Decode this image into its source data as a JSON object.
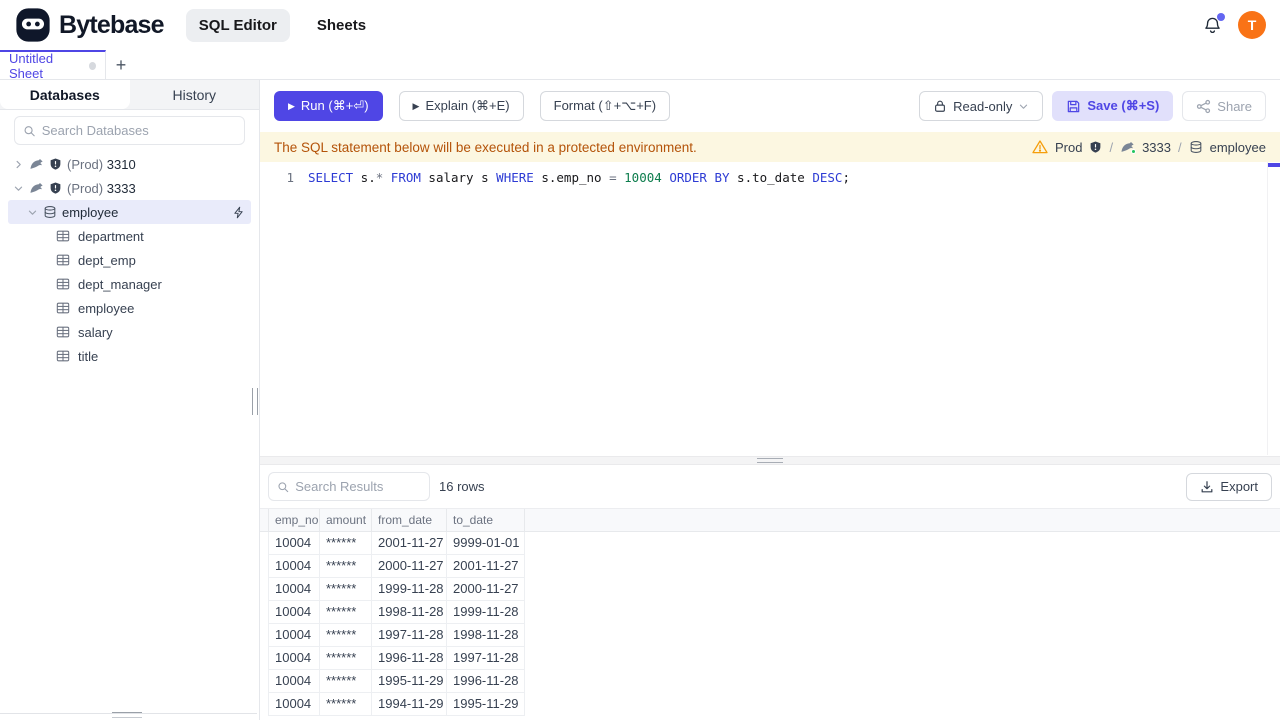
{
  "colors": {
    "accent": "#4f46e5",
    "accent_light": "#e1e0fb",
    "selected_row": "#e9ebfa",
    "banner_bg": "#fcf7e1",
    "banner_text": "#b45309",
    "warning": "#f59e0b",
    "avatar_bg": "#f97316",
    "notification_dot": "#6366f1",
    "sql_keyword": "#2d3bd4",
    "sql_number": "#0d7d4d",
    "sql_operator": "#6b7280"
  },
  "header": {
    "brand": "Bytebase",
    "nav": [
      {
        "label": "SQL Editor",
        "active": true
      },
      {
        "label": "Sheets",
        "active": false
      }
    ],
    "avatar_initial": "T"
  },
  "sheet_tabs": {
    "active_tab": "Untitled Sheet",
    "new_tab_label": "+"
  },
  "sidebar": {
    "tabs": [
      {
        "label": "Databases",
        "active": true
      },
      {
        "label": "History",
        "active": false
      }
    ],
    "search_placeholder": "Search Databases",
    "tree": {
      "instances": [
        {
          "env": "(Prod)",
          "name": "3310",
          "expanded": false
        },
        {
          "env": "(Prod)",
          "name": "3333",
          "expanded": true
        }
      ],
      "database": "employee",
      "tables": [
        "department",
        "dept_emp",
        "dept_manager",
        "employee",
        "salary",
        "title"
      ]
    }
  },
  "toolbar": {
    "run": "Run (⌘+⏎)",
    "explain": "Explain (⌘+E)",
    "format": "Format (⇧+⌥+F)",
    "readonly": "Read-only",
    "save": "Save (⌘+S)",
    "share": "Share"
  },
  "banner": {
    "message": "The SQL statement below will be executed in a protected environment.",
    "environment": "Prod",
    "instance": "3333",
    "database": "employee",
    "separator": "/"
  },
  "editor": {
    "line_number": "1",
    "sql_text": "SELECT s.* FROM salary s WHERE s.emp_no = 10004 ORDER BY s.to_date DESC;",
    "tokens": [
      {
        "text": "SELECT",
        "type": "kw"
      },
      {
        "text": " s.",
        "type": "id"
      },
      {
        "text": "*",
        "type": "op"
      },
      {
        "text": " ",
        "type": "id"
      },
      {
        "text": "FROM",
        "type": "kw"
      },
      {
        "text": " salary s ",
        "type": "id"
      },
      {
        "text": "WHERE",
        "type": "kw"
      },
      {
        "text": " s.emp_no ",
        "type": "id"
      },
      {
        "text": "=",
        "type": "op"
      },
      {
        "text": " ",
        "type": "id"
      },
      {
        "text": "10004",
        "type": "num"
      },
      {
        "text": " ",
        "type": "id"
      },
      {
        "text": "ORDER BY",
        "type": "kw"
      },
      {
        "text": " s.to_date ",
        "type": "id"
      },
      {
        "text": "DESC",
        "type": "kw"
      },
      {
        "text": ";",
        "type": "id"
      }
    ]
  },
  "results": {
    "search_placeholder": "Search Results",
    "row_count": "16 rows",
    "export": "Export",
    "columns": [
      "emp_no",
      "amount",
      "from_date",
      "to_date"
    ],
    "rows": [
      [
        "10004",
        "******",
        "2001-11-27",
        "9999-01-01"
      ],
      [
        "10004",
        "******",
        "2000-11-27",
        "2001-11-27"
      ],
      [
        "10004",
        "******",
        "1999-11-28",
        "2000-11-27"
      ],
      [
        "10004",
        "******",
        "1998-11-28",
        "1999-11-28"
      ],
      [
        "10004",
        "******",
        "1997-11-28",
        "1998-11-28"
      ],
      [
        "10004",
        "******",
        "1996-11-28",
        "1997-11-28"
      ],
      [
        "10004",
        "******",
        "1995-11-29",
        "1996-11-28"
      ],
      [
        "10004",
        "******",
        "1994-11-29",
        "1995-11-29"
      ]
    ]
  }
}
